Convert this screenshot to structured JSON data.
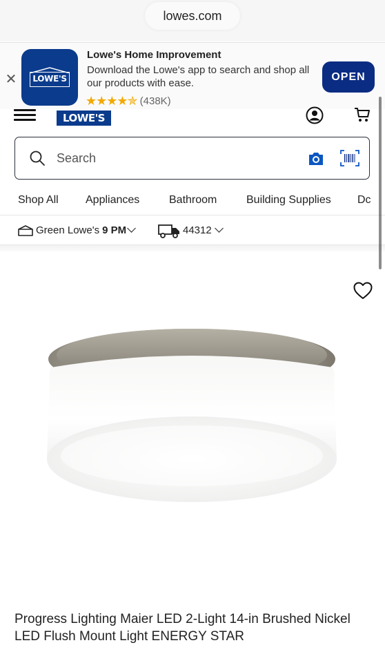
{
  "browser": {
    "url": "lowes.com"
  },
  "app_banner": {
    "title": "Lowe's Home Improvement",
    "description": "Download the Lowe's app to search and shop all our products with ease.",
    "stars": "★★★★✯",
    "rating": 4.5,
    "rating_count": "(438K)",
    "open_label": "OPEN",
    "icon_logo_text": "LOWE'S",
    "brand_color": "#0b3b8c"
  },
  "header": {
    "logo_text": "LOWE'S",
    "icons": [
      "menu-icon",
      "account-icon",
      "cart-icon"
    ]
  },
  "search": {
    "placeholder": "Search",
    "icons": [
      "search-icon",
      "camera-icon",
      "barcode-icon"
    ]
  },
  "nav": {
    "items": [
      "Shop All",
      "Appliances",
      "Bathroom",
      "Building Supplies",
      "Dc"
    ]
  },
  "store": {
    "name": "Green Lowe's",
    "hours": "9 PM",
    "zip": "44312"
  },
  "product": {
    "title": "Progress Lighting Maier LED 2-Light 14-in Brushed Nickel LED Flush Mount Light ENERGY STAR",
    "favorite_icon": "heart-icon"
  },
  "colors": {
    "accent": "#0b2c83",
    "star": "#f2a900"
  }
}
